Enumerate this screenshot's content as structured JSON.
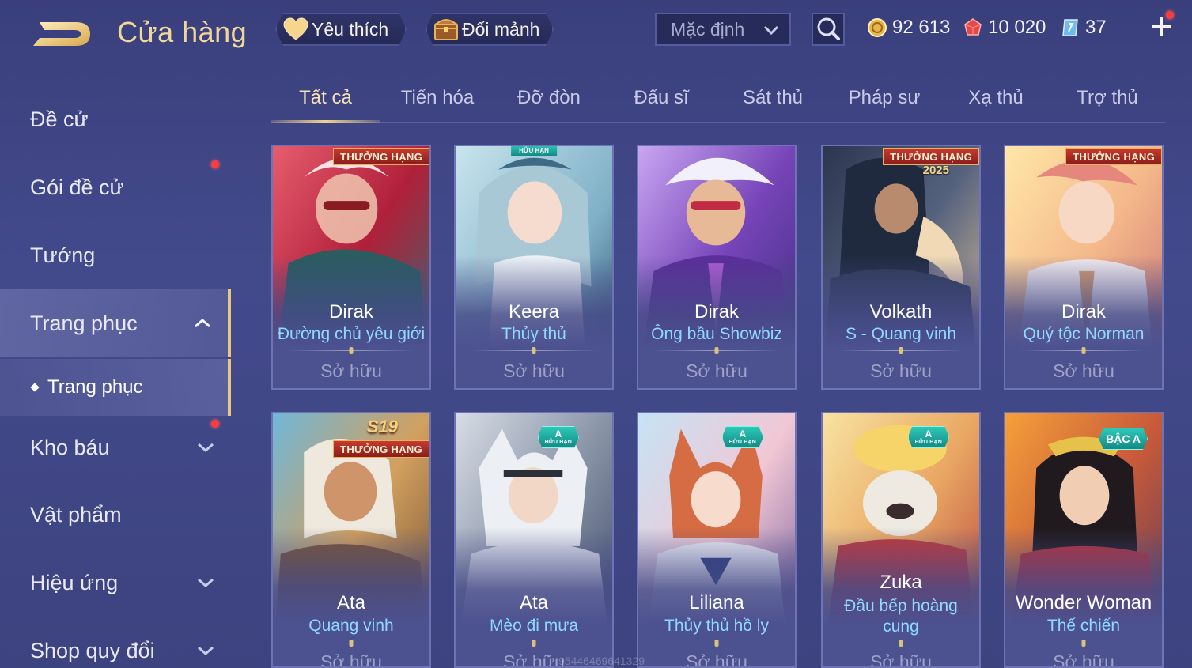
{
  "header": {
    "title": "Cửa hàng",
    "favorite_label": "Yêu thích",
    "exchange_label": "Đổi mảnh",
    "sort_value": "Mặc định",
    "currencies": {
      "gold": "92 613",
      "ruby": "10 020",
      "voucher": "37"
    }
  },
  "sidebar": {
    "items": [
      {
        "label": "Đề cử"
      },
      {
        "label": "Gói đề cử"
      },
      {
        "label": "Tướng"
      },
      {
        "label": "Trang phục"
      },
      {
        "label": "Kho báu"
      },
      {
        "label": "Vật phẩm"
      },
      {
        "label": "Hiệu ứng"
      },
      {
        "label": "Shop quy đổi"
      }
    ],
    "sub_item": "Trang phục"
  },
  "tabs": [
    "Tất cả",
    "Tiến hóa",
    "Đỡ đòn",
    "Đấu sĩ",
    "Sát thủ",
    "Pháp sư",
    "Xạ thủ",
    "Trợ thủ"
  ],
  "cards": [
    {
      "hero": "Dirak",
      "skin": "Đường chủ yêu giới",
      "status": "Sở hữu",
      "badge": "THƯỞNG HẠNG"
    },
    {
      "hero": "Keera",
      "skin": "Thủy thủ",
      "status": "Sở hữu",
      "badge": "HỮU HẠN"
    },
    {
      "hero": "Dirak",
      "skin": "Ông bầu Showbiz",
      "status": "Sở hữu"
    },
    {
      "hero": "Volkath",
      "skin": "S - Quang vinh",
      "status": "Sở hữu",
      "badge": "THƯỞNG HẠNG",
      "badge_year": "2025"
    },
    {
      "hero": "Dirak",
      "skin": "Quý tộc Norman",
      "status": "Sở hữu",
      "badge": "THƯỞNG HẠNG"
    },
    {
      "hero": "Ata",
      "skin": "Quang vinh",
      "status": "Sở hữu",
      "badge": "THƯỞNG HẠNG",
      "badge_season": "S19"
    },
    {
      "hero": "Ata",
      "skin": "Mèo đi mưa",
      "status": "Sở hữu",
      "tier": "A",
      "tier_sub": "HỮU HẠN"
    },
    {
      "hero": "Liliana",
      "skin": "Thủy thủ hồ ly",
      "status": "Sở hữu",
      "tier": "A",
      "tier_sub": "HỮU HẠN"
    },
    {
      "hero": "Zuka",
      "skin": "Đầu bếp hoàng cung",
      "status": "Sở hữu",
      "tier": "A",
      "tier_sub": "HỮU HẠN"
    },
    {
      "hero": "Wonder Woman",
      "skin": "Thế chiến",
      "status": "Sở hữu",
      "tier": "BẬC A"
    }
  ],
  "watermark": "95446469641329",
  "colors": {
    "background": "#3e4484",
    "gold_text": "#f1d79a",
    "skin_text": "#8fd8ff",
    "rank_badge": "#b8302a",
    "tier_badge": "#1fa99f",
    "notification": "#ff3b3b"
  },
  "icons": {
    "back": "back-arrow-icon",
    "favorite": "heart-icon",
    "exchange": "treasure-chest-icon",
    "sort": "chevron-down-icon",
    "search": "search-icon",
    "gold": "gold-coin-icon",
    "ruby": "ruby-gem-icon",
    "voucher": "voucher-card-icon",
    "add": "plus-icon"
  }
}
